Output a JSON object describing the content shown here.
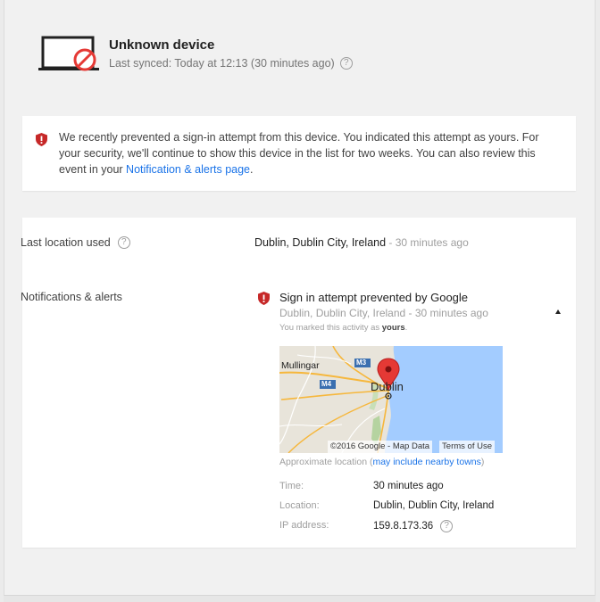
{
  "device": {
    "title": "Unknown device",
    "last_synced": "Last synced: Today at 12:13 (30 minutes ago)"
  },
  "alert": {
    "text_before": "We recently prevented a sign-in attempt from this device. You indicated this attempt as yours. For your security, we'll continue to show this device in the list for two weeks. You can also review this event in your ",
    "link_text": "Notification & alerts page",
    "text_after": "."
  },
  "details": {
    "last_location_label": "Last location used",
    "last_location_value": "Dublin, Dublin City, Ireland",
    "last_location_time": " - 30 minutes ago",
    "notifications_label": "Notifications & alerts"
  },
  "notification": {
    "title": "Sign in attempt prevented by Google",
    "subtitle": "Dublin, Dublin City, Ireland - 30 minutes ago",
    "marked_prefix": "You marked this activity as ",
    "marked_value": "yours",
    "marked_suffix": "."
  },
  "map": {
    "labels": {
      "town": "Mullingar",
      "city": "Dublin",
      "road_m3": "M3",
      "road_m4": "M4"
    },
    "attribution": "©2016 Google - Map Data",
    "terms": "Terms of Use",
    "approx_prefix": "Approximate location (",
    "approx_link": "may include nearby towns",
    "approx_suffix": ")"
  },
  "info": {
    "time_label": "Time:",
    "time_value": "30 minutes ago",
    "location_label": "Location:",
    "location_value": "Dublin, Dublin City, Ireland",
    "ip_label": "IP address:",
    "ip_value": "159.8.173.36"
  },
  "help_glyph": "?",
  "colors": {
    "accent_link": "#1a73e8",
    "alert_red": "#c62828",
    "water": "#a3ccff",
    "land": "#e8e4da"
  },
  "icons": [
    "laptop-blocked-icon",
    "shield-alert-icon",
    "help-icon",
    "map-pin-icon",
    "collapse-arrow-icon"
  ]
}
